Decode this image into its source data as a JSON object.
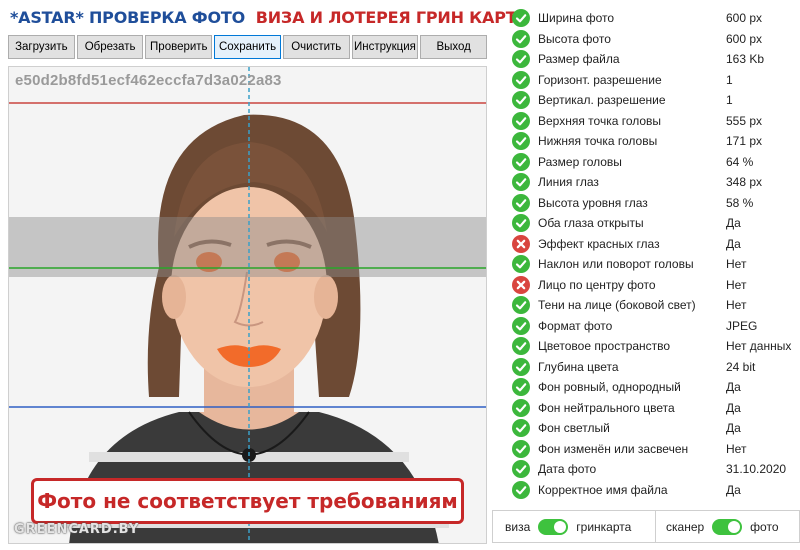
{
  "title": {
    "part1": "*ASTAR* ПРОВЕРКА ФОТО",
    "part2": "ВИЗА И ЛОТЕРЕЯ ГРИН КАРТА"
  },
  "toolbar": {
    "buttons": [
      "Загрузить",
      "Обрезать",
      "Проверить",
      "Сохранить",
      "Очистить",
      "Инструкция",
      "Выход"
    ],
    "active_index": 3
  },
  "photo": {
    "hash": "e50d2b8fd51ecf462eccfa7d3a022a83",
    "banner": "Фото не соответствует требованиям",
    "watermark": "GREENCARD.BY"
  },
  "checks": [
    {
      "label": "Ширина фото",
      "value": "600 px",
      "status": "ok"
    },
    {
      "label": "Высота фото",
      "value": "600 px",
      "status": "ok"
    },
    {
      "label": "Размер файла",
      "value": "163 Kb",
      "status": "ok"
    },
    {
      "label": "Горизонт. разрешение",
      "value": "1",
      "status": "ok"
    },
    {
      "label": "Вертикал. разрешение",
      "value": "1",
      "status": "ok"
    },
    {
      "label": "Верхняя точка головы",
      "value": "555 px",
      "status": "ok"
    },
    {
      "label": "Нижняя точка головы",
      "value": "171 px",
      "status": "ok"
    },
    {
      "label": "Размер головы",
      "value": "64 %",
      "status": "ok"
    },
    {
      "label": "Линия глаз",
      "value": "348 px",
      "status": "ok"
    },
    {
      "label": "Высота уровня глаз",
      "value": "58 %",
      "status": "ok"
    },
    {
      "label": "Оба глаза открыты",
      "value": "Да",
      "status": "ok"
    },
    {
      "label": "Эффект красных глаз",
      "value": "Да",
      "status": "fail"
    },
    {
      "label": "Наклон или поворот головы",
      "value": "Нет",
      "status": "ok"
    },
    {
      "label": "Лицо по центру фото",
      "value": "Нет",
      "status": "fail"
    },
    {
      "label": "Тени на лице (боковой свет)",
      "value": "Нет",
      "status": "ok"
    },
    {
      "label": "Формат фото",
      "value": "JPEG",
      "status": "ok"
    },
    {
      "label": "Цветовое пространство",
      "value": "Нет данных",
      "status": "ok"
    },
    {
      "label": "Глубина цвета",
      "value": "24 bit",
      "status": "ok"
    },
    {
      "label": "Фон ровный, однородный",
      "value": "Да",
      "status": "ok"
    },
    {
      "label": "Фон нейтрального цвета",
      "value": "Да",
      "status": "ok"
    },
    {
      "label": "Фон светлый",
      "value": "Да",
      "status": "ok"
    },
    {
      "label": "Фон изменён или засвечен",
      "value": "Нет",
      "status": "ok"
    },
    {
      "label": "Дата фото",
      "value": "31.10.2020",
      "status": "ok"
    },
    {
      "label": "Корректное имя файла",
      "value": "Да",
      "status": "ok"
    }
  ],
  "footer": {
    "left_label": "виза",
    "left_value": "гринкарта",
    "right_label": "сканер",
    "right_value": "фото"
  },
  "colors": {
    "ok": "#3cb73c",
    "fail": "#d9453f",
    "title_blue": "#1f4e9a",
    "title_red": "#c62828",
    "toggle": "#3ec23e"
  }
}
